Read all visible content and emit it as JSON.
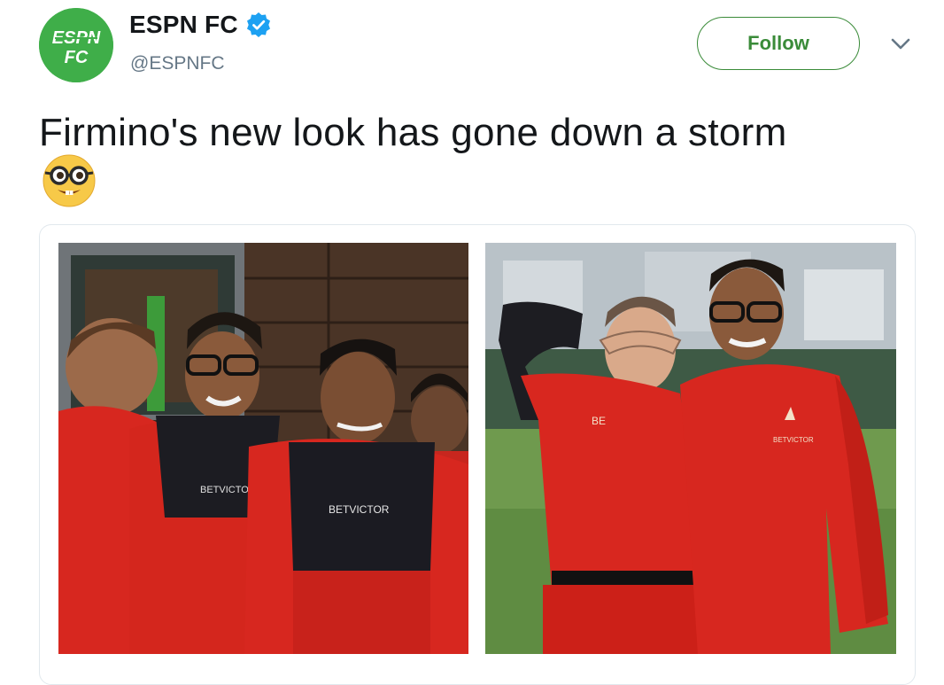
{
  "account": {
    "display_name": "ESPN FC",
    "handle": "@ESPNFC",
    "verified": true,
    "avatar_icon": "espn-fc-logo",
    "avatar_color": "#3fae49"
  },
  "actions": {
    "follow_label": "Follow",
    "follow_color": "#3a8b39",
    "more_icon": "chevron-down-icon"
  },
  "tweet": {
    "text": "Firmino's new look has gone down a storm",
    "emoji": "nerd-face-emoji"
  },
  "media": {
    "photos": [
      {
        "icon": "photo-players-laughing"
      },
      {
        "icon": "photo-players-posing-glasses"
      }
    ],
    "shirt_sponsor": "BETVICTOR"
  }
}
